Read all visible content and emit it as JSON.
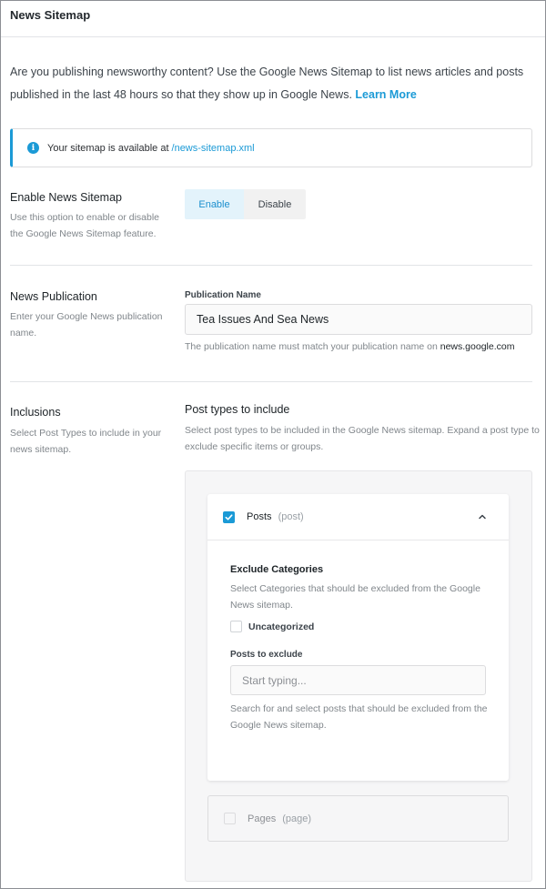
{
  "header": {
    "title": "News Sitemap"
  },
  "intro": {
    "text": "Are you publishing newsworthy content? Use the Google News Sitemap to list news articles and posts published in the last 48 hours so that they show up in Google News.",
    "link": "Learn More"
  },
  "notice": {
    "text": "Your sitemap is available at",
    "link": "/news-sitemap.xml",
    "icon": "info-icon",
    "accent": "#1b9ad6"
  },
  "enable": {
    "title": "Enable News Sitemap",
    "desc": "Use this option to enable or disable the Google News Sitemap feature.",
    "options": [
      "Enable",
      "Disable"
    ],
    "selected": "Enable"
  },
  "publication": {
    "title": "News Publication",
    "desc": "Enter your Google News publication name.",
    "field_label": "Publication Name",
    "value": "Tea Issues And Sea News",
    "help_prefix": "The publication name must match your publication name on",
    "help_domain": "news.google.com"
  },
  "inclusions": {
    "title": "Inclusions",
    "desc": "Select Post Types to include in your news sitemap.",
    "section_title": "Post types to include",
    "section_desc": "Select post types to be included in the Google News sitemap. Expand a post type to exclude specific items or groups.",
    "posts": {
      "label": "Posts",
      "slug": "(post)",
      "checked": true,
      "exclude_title": "Exclude Categories",
      "exclude_desc": "Select Categories that should be excluded from the Google News sitemap.",
      "categories": [
        {
          "label": "Uncategorized",
          "checked": false
        }
      ],
      "posts_exclude_label": "Posts to exclude",
      "search_placeholder": "Start typing...",
      "search_help": "Search for and select posts that should be excluded from the Google News sitemap."
    },
    "pages": {
      "label": "Pages",
      "slug": "(page)",
      "checked": false
    }
  }
}
